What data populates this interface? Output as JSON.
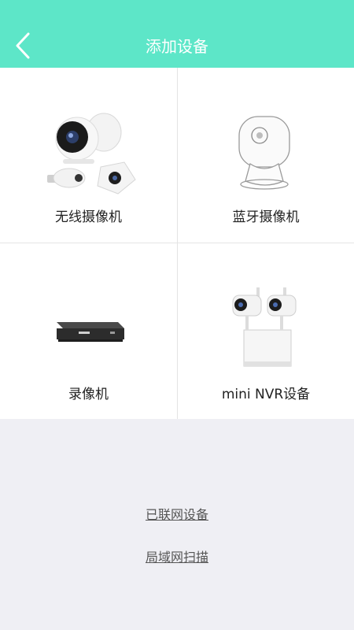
{
  "header": {
    "title": "添加设备",
    "back_icon": "chevron-left-icon",
    "background": "#5de6c8"
  },
  "devices": [
    {
      "label": "无线摄像机",
      "icon": "wireless-camera-image"
    },
    {
      "label": "蓝牙摄像机",
      "icon": "bluetooth-camera-image"
    },
    {
      "label": "录像机",
      "icon": "video-recorder-image"
    },
    {
      "label": "mini NVR设备",
      "icon": "mini-nvr-image"
    }
  ],
  "links": {
    "connected_devices": "已联网设备",
    "lan_scan": "局域网扫描"
  }
}
